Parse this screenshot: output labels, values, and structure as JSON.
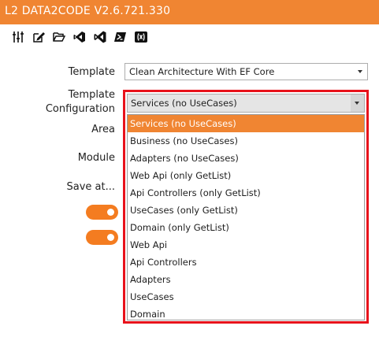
{
  "window": {
    "title": "L2 DATA2CODE V2.6.721.330"
  },
  "toolbar": {
    "icons": [
      "settings-sliders-icon",
      "edit-icon",
      "open-folder-icon",
      "visual-studio-icon",
      "visual-studio-code-icon",
      "powershell-icon",
      "variable-icon"
    ]
  },
  "form": {
    "template_label": "Template",
    "template_value": "Clean Architecture With EF Core",
    "config_label_line1": "Template",
    "config_label_line2": "Configuration",
    "config_value": "Services (no UseCases)",
    "area_label": "Area",
    "module_label": "Module",
    "saveat_label": "Save at..."
  },
  "dropdown": {
    "options": [
      "Services (no UseCases)",
      "Business (no UseCases)",
      "Adapters (no UseCases)",
      "Web Api (only GetList)",
      "Api Controllers (only GetList)",
      "UseCases (only GetList)",
      "Domain (only GetList)",
      "Web Api",
      "Api Controllers",
      "Adapters",
      "UseCases",
      "Domain"
    ],
    "selected": "Services (no UseCases)"
  },
  "colors": {
    "accent": "#f08532",
    "highlight_border": "#e8121b"
  }
}
